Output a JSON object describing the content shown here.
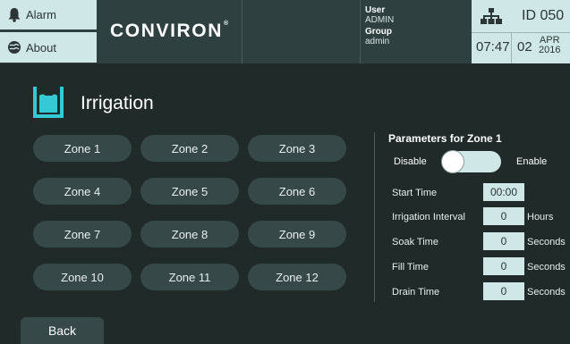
{
  "header": {
    "alarm_label": "Alarm",
    "about_label": "About",
    "logo_text": "CONVIRON",
    "logo_tm": "®",
    "user_label": "User",
    "user_value": "ADMIN",
    "group_label": "Group",
    "group_value": "admin",
    "id_text": "ID  050",
    "time": "07:47",
    "day": "02",
    "month": "APR",
    "year": "2016"
  },
  "page": {
    "title": "Irrigation",
    "icon": "irrigation-tank-icon"
  },
  "zones": [
    "Zone 1",
    "Zone 2",
    "Zone 3",
    "Zone 4",
    "Zone 5",
    "Zone 6",
    "Zone 7",
    "Zone 8",
    "Zone 9",
    "Zone 10",
    "Zone 11",
    "Zone 12"
  ],
  "params": {
    "title": "Parameters for Zone 1",
    "disable_label": "Disable",
    "enable_label": "Enable",
    "enabled": false,
    "start_time_label": "Start Time",
    "start_time_value": "00:00",
    "interval_label": "Irrigation Interval",
    "interval_value": "0",
    "interval_unit": "Hours",
    "soak_label": "Soak Time",
    "soak_value": "0",
    "soak_unit": "Seconds",
    "fill_label": "Fill Time",
    "fill_value": "0",
    "fill_unit": "Seconds",
    "drain_label": "Drain Time",
    "drain_value": "0",
    "drain_unit": "Seconds"
  },
  "back_label": "Back",
  "colors": {
    "background": "#1f2a29",
    "header": "#2f4040",
    "light_accent": "#cfe7e6",
    "button": "#364847",
    "icon_accent": "#35c9d6"
  }
}
